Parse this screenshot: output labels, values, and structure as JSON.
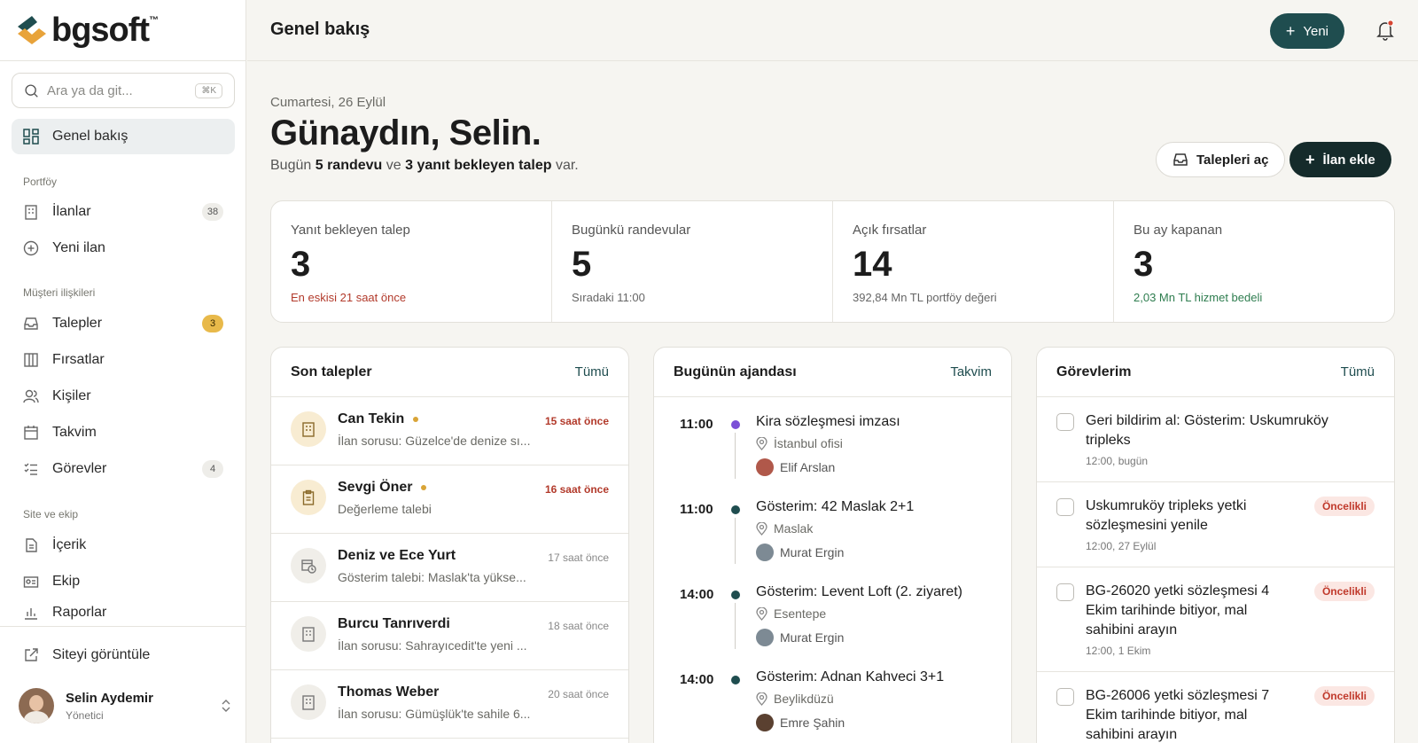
{
  "brand": {
    "name": "bgsoft",
    "tm": "™"
  },
  "search": {
    "placeholder": "Ara ya da git...",
    "shortcut": "⌘K"
  },
  "sidebar": {
    "overview": "Genel bakış",
    "section_portfolio": "Portföy",
    "listings": "İlanlar",
    "listings_count": "38",
    "new_listing": "Yeni ilan",
    "section_crm": "Müşteri ilişkileri",
    "requests": "Talepler",
    "requests_count": "3",
    "opportunities": "Fırsatlar",
    "contacts": "Kişiler",
    "calendar": "Takvim",
    "tasks": "Görevler",
    "tasks_count": "4",
    "section_site": "Site ve ekip",
    "content": "İçerik",
    "team": "Ekip",
    "reports": "Raporlar",
    "view_site": "Siteyi görüntüle"
  },
  "user": {
    "name": "Selin Aydemir",
    "role": "Yönetici"
  },
  "topbar": {
    "title": "Genel bakış",
    "new_button": "Yeni"
  },
  "hero": {
    "date": "Cumartesi, 26 Eylül",
    "greeting": "Günaydın, Selin.",
    "sub_pre": "Bugün ",
    "sub_b1": "5 randevu",
    "sub_mid": " ve ",
    "sub_b2": "3 yanıt bekleyen talep",
    "sub_post": " var.",
    "open_requests": "Talepleri aç",
    "add_listing": "İlan ekle"
  },
  "stats": [
    {
      "label": "Yanıt bekleyen talep",
      "value": "3",
      "note": "En eskisi 21 saat önce"
    },
    {
      "label": "Bugünkü randevular",
      "value": "5",
      "note": "Sıradaki 11:00"
    },
    {
      "label": "Açık fırsatlar",
      "value": "14",
      "note": "392,84 Mn TL portföy değeri"
    },
    {
      "label": "Bu ay kapanan",
      "value": "3",
      "note": "2,03 Mn TL hizmet bedeli"
    }
  ],
  "requests_card": {
    "title": "Son talepler",
    "link": "Tümü",
    "items": [
      {
        "name": "Can Tekin",
        "desc": "İlan sorusu: Güzelce'de denize sı...",
        "time": "15 saat önce"
      },
      {
        "name": "Sevgi Öner",
        "desc": "Değerleme talebi",
        "time": "16 saat önce"
      },
      {
        "name": "Deniz ve Ece Yurt",
        "desc": "Gösterim talebi: Maslak'ta yükse...",
        "time": "17 saat önce"
      },
      {
        "name": "Burcu Tanrıverdi",
        "desc": "İlan sorusu: Sahrayıcedit'te yeni ...",
        "time": "18 saat önce"
      },
      {
        "name": "Thomas Weber",
        "desc": "İlan sorusu: Gümüşlük'te sahile 6...",
        "time": "20 saat önce"
      }
    ]
  },
  "agenda_card": {
    "title": "Bugünün ajandası",
    "link": "Takvim",
    "items": [
      {
        "time": "11:00",
        "title": "Kira sözleşmesi imzası",
        "location": "İstanbul ofisi",
        "person": "Elif Arslan"
      },
      {
        "time": "11:00",
        "title": "Gösterim: 42 Maslak 2+1",
        "location": "Maslak",
        "person": "Murat Ergin"
      },
      {
        "time": "14:00",
        "title": "Gösterim: Levent Loft (2. ziyaret)",
        "location": "Esentepe",
        "person": "Murat Ergin"
      },
      {
        "time": "14:00",
        "title": "Gösterim: Adnan Kahveci 3+1",
        "location": "Beylikdüzü",
        "person": "Emre Şahin"
      }
    ]
  },
  "tasks_card": {
    "title": "Görevlerim",
    "link": "Tümü",
    "priority_label": "Öncelikli",
    "items": [
      {
        "title": "Geri bildirim al: Gösterim: Uskumruköy tripleks",
        "meta": "12:00, bugün"
      },
      {
        "title": "Uskumruköy tripleks yetki sözleşmesini yenile",
        "meta": "12:00, 27 Eylül"
      },
      {
        "title": "BG-26020 yetki sözleşmesi 4 Ekim tarihinde bitiyor, mal sahibini arayın",
        "meta": "12:00, 1 Ekim"
      },
      {
        "title": "BG-26006 yetki sözleşmesi 7 Ekim tarihinde bitiyor, mal sahibini arayın",
        "meta": ""
      }
    ]
  },
  "colors": {
    "accent": "#1f4d4f",
    "dark": "#152b2b",
    "warn": "#e8b94a",
    "danger": "#b23a2b",
    "success": "#2e7d4f"
  }
}
